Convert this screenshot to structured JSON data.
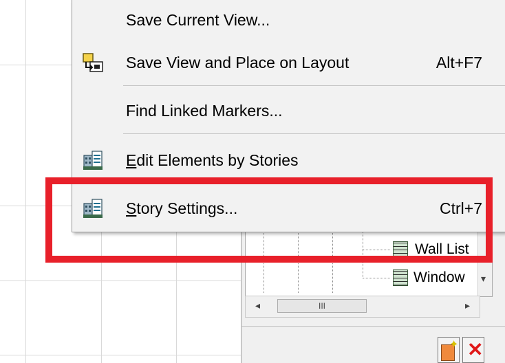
{
  "menu": {
    "items": [
      {
        "label": "Save Current View...",
        "shortcut": "",
        "icon": ""
      },
      {
        "label": "Save View and Place on Layout",
        "shortcut": "Alt+F7",
        "icon": "place-on-layout-icon"
      },
      {
        "label": "Find Linked Markers...",
        "shortcut": "",
        "icon": ""
      },
      {
        "label_first": "E",
        "label_rest": "dit Elements by Stories",
        "shortcut": "",
        "icon": "stories-icon"
      },
      {
        "label_first": "S",
        "label_rest": "tory Settings...",
        "shortcut": "Ctrl+7",
        "icon": "story-settings-icon"
      }
    ]
  },
  "navigator": {
    "rows": [
      {
        "label": "Wall List"
      },
      {
        "label": "Window"
      }
    ],
    "scrollbar_thumb_grip": "III"
  },
  "colors": {
    "highlight": "#e8202a",
    "menu_bg": "#f2f2f2"
  }
}
